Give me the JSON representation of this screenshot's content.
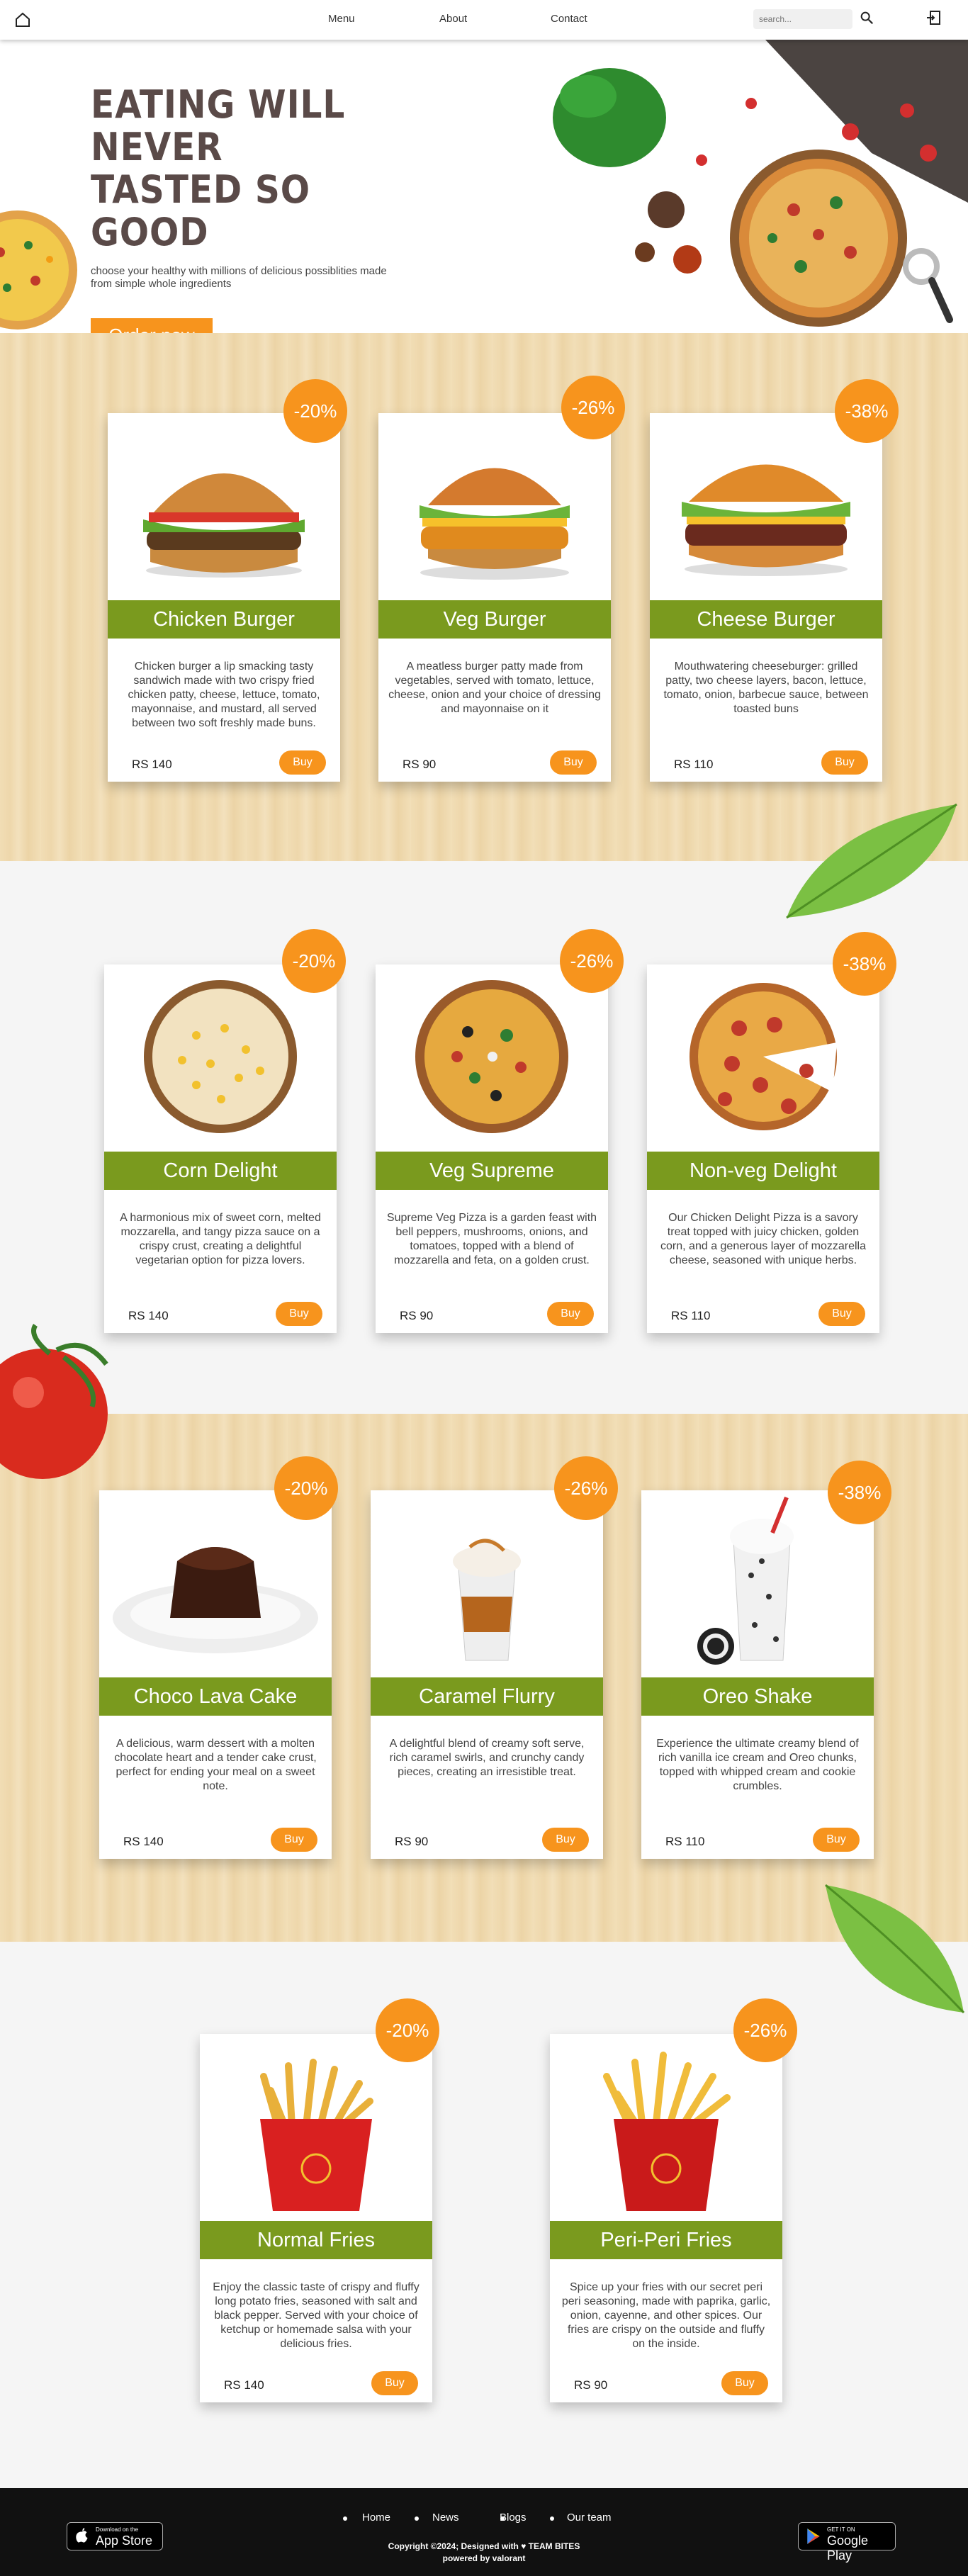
{
  "nav": {
    "links": [
      "Menu",
      "About",
      "Contact"
    ],
    "search_placeholder": "search..."
  },
  "hero": {
    "title": "EATING WILL NEVER TASTED SO GOOD",
    "subtitle": "choose your healthy with millions of delicious possiblities made from simple whole ingredients",
    "cta": "Order now"
  },
  "sections": [
    {
      "items": [
        {
          "name": "Chicken Burger",
          "discount": "-20%",
          "price": "RS 140",
          "buy": "Buy",
          "desc": "Chicken burger a lip smacking tasty sandwich made with two crispy fried chicken patty, cheese, lettuce, tomato, mayonnaise, and mustard, all served between two soft freshly made buns."
        },
        {
          "name": "Veg Burger",
          "discount": "-26%",
          "price": "RS 90",
          "buy": "Buy",
          "desc": "A meatless burger patty made from vegetables, served with tomato, lettuce, cheese, onion and your choice of dressing and mayonnaise on it"
        },
        {
          "name": "Cheese Burger",
          "discount": "-38%",
          "price": "RS 110",
          "buy": "Buy",
          "desc": "Mouthwatering cheeseburger: grilled patty, two cheese layers, bacon, lettuce, tomato, onion, barbecue sauce, between toasted buns"
        }
      ]
    },
    {
      "items": [
        {
          "name": "Corn Delight",
          "discount": "-20%",
          "price": "RS 140",
          "buy": "Buy",
          "desc": "A harmonious mix of sweet corn, melted mozzarella, and tangy pizza sauce on a crispy crust, creating a delightful vegetarian option for pizza lovers."
        },
        {
          "name": "Veg Supreme",
          "discount": "-26%",
          "price": "RS 90",
          "buy": "Buy",
          "desc": "Supreme Veg Pizza is a garden feast with bell peppers, mushrooms, onions, and tomatoes, topped with a blend of mozzarella and feta, on a golden crust."
        },
        {
          "name": "Non-veg Delight",
          "discount": "-38%",
          "price": "RS 110",
          "buy": "Buy",
          "desc": "Our Chicken Delight Pizza is a savory treat topped with juicy chicken, golden corn, and a generous layer of mozzarella cheese, seasoned with unique herbs."
        }
      ]
    },
    {
      "items": [
        {
          "name": "Choco Lava Cake",
          "discount": "-20%",
          "price": "RS 140",
          "buy": "Buy",
          "desc": "A delicious, warm dessert with a molten chocolate heart and a tender cake crust, perfect for ending your meal on a sweet note."
        },
        {
          "name": "Caramel Flurry",
          "discount": "-26%",
          "price": "RS 90",
          "buy": "Buy",
          "desc": "A delightful blend of creamy soft serve, rich caramel swirls, and crunchy candy pieces, creating an irresistible treat."
        },
        {
          "name": "Oreo Shake",
          "discount": "-38%",
          "price": "RS 110",
          "buy": "Buy",
          "desc": "Experience the ultimate creamy blend of rich vanilla ice cream and Oreo chunks, topped with whipped cream and cookie crumbles."
        }
      ]
    },
    {
      "items": [
        {
          "name": "Normal Fries",
          "discount": "-20%",
          "price": "RS 140",
          "buy": "Buy",
          "desc": "Enjoy the classic taste of crispy and fluffy long potato fries, seasoned with salt and black pepper. Served with your choice of ketchup or homemade salsa with your delicious fries."
        },
        {
          "name": "Peri-Peri Fries",
          "discount": "-26%",
          "price": "RS 90",
          "buy": "Buy",
          "desc": "Spice up your fries with our secret peri peri seasoning, made with paprika, garlic, onion, cayenne, and other spices. Our fries are crispy on the outside and fluffy on the inside."
        }
      ]
    }
  ],
  "footer": {
    "links": [
      "Home",
      "News",
      "Blogs",
      "Our team"
    ],
    "copyright": "Copyright ©2024; Designed with ♥ TEAM BITES",
    "powered": "powered by valorant",
    "appstore_small": "Download on the",
    "appstore_big": "App Store",
    "play_small": "GET IT ON",
    "play_big": "Google Play"
  },
  "colors": {
    "accent": "#f7941d",
    "title_bar": "#7a9a1e",
    "headline": "#5a4a48"
  }
}
